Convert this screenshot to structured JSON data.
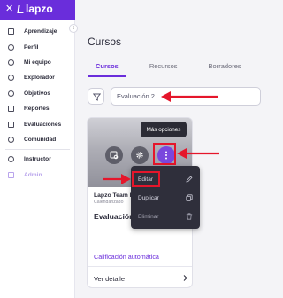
{
  "app": {
    "logo_text": "lapzo"
  },
  "sidebar": {
    "items": [
      {
        "label": "Aprendizaje",
        "icon": "book-icon"
      },
      {
        "label": "Perfil",
        "icon": "user-icon"
      },
      {
        "label": "Mi equipo",
        "icon": "team-icon"
      },
      {
        "label": "Explorador",
        "icon": "search-icon"
      },
      {
        "label": "Objetivos",
        "icon": "target-icon"
      },
      {
        "label": "Reportes",
        "icon": "report-icon"
      },
      {
        "label": "Evaluaciones",
        "icon": "code-icon"
      },
      {
        "label": "Comunidad",
        "icon": "heart-icon"
      }
    ],
    "lower_items": [
      {
        "label": "Instructor",
        "icon": "instructor-icon"
      },
      {
        "label": "Admin",
        "icon": "admin-icon"
      }
    ]
  },
  "main": {
    "title": "Cursos",
    "tabs": [
      {
        "label": "Cursos",
        "active": true
      },
      {
        "label": "Recursos",
        "active": false
      },
      {
        "label": "Borradores",
        "active": false
      }
    ],
    "search": {
      "value": "Evaluación 2"
    }
  },
  "card": {
    "tooltip": "Más opciones",
    "org": "Lapzo Team P",
    "subtitle": "Calendarizado",
    "name": "Evaluación 2",
    "rating_link": "Calificación automática",
    "detail_link": "Ver detalle"
  },
  "menu": {
    "items": [
      {
        "label": "Editar",
        "icon": "pencil-icon",
        "highlighted": true
      },
      {
        "label": "Duplicar",
        "icon": "copy-icon",
        "highlighted": false
      },
      {
        "label": "Eliminar",
        "icon": "trash-icon",
        "highlighted": false,
        "disabled": true
      }
    ]
  },
  "colors": {
    "brand": "#6a2ddb",
    "annotation_red": "#e5162b",
    "menu_bg": "#2f2f3b"
  }
}
